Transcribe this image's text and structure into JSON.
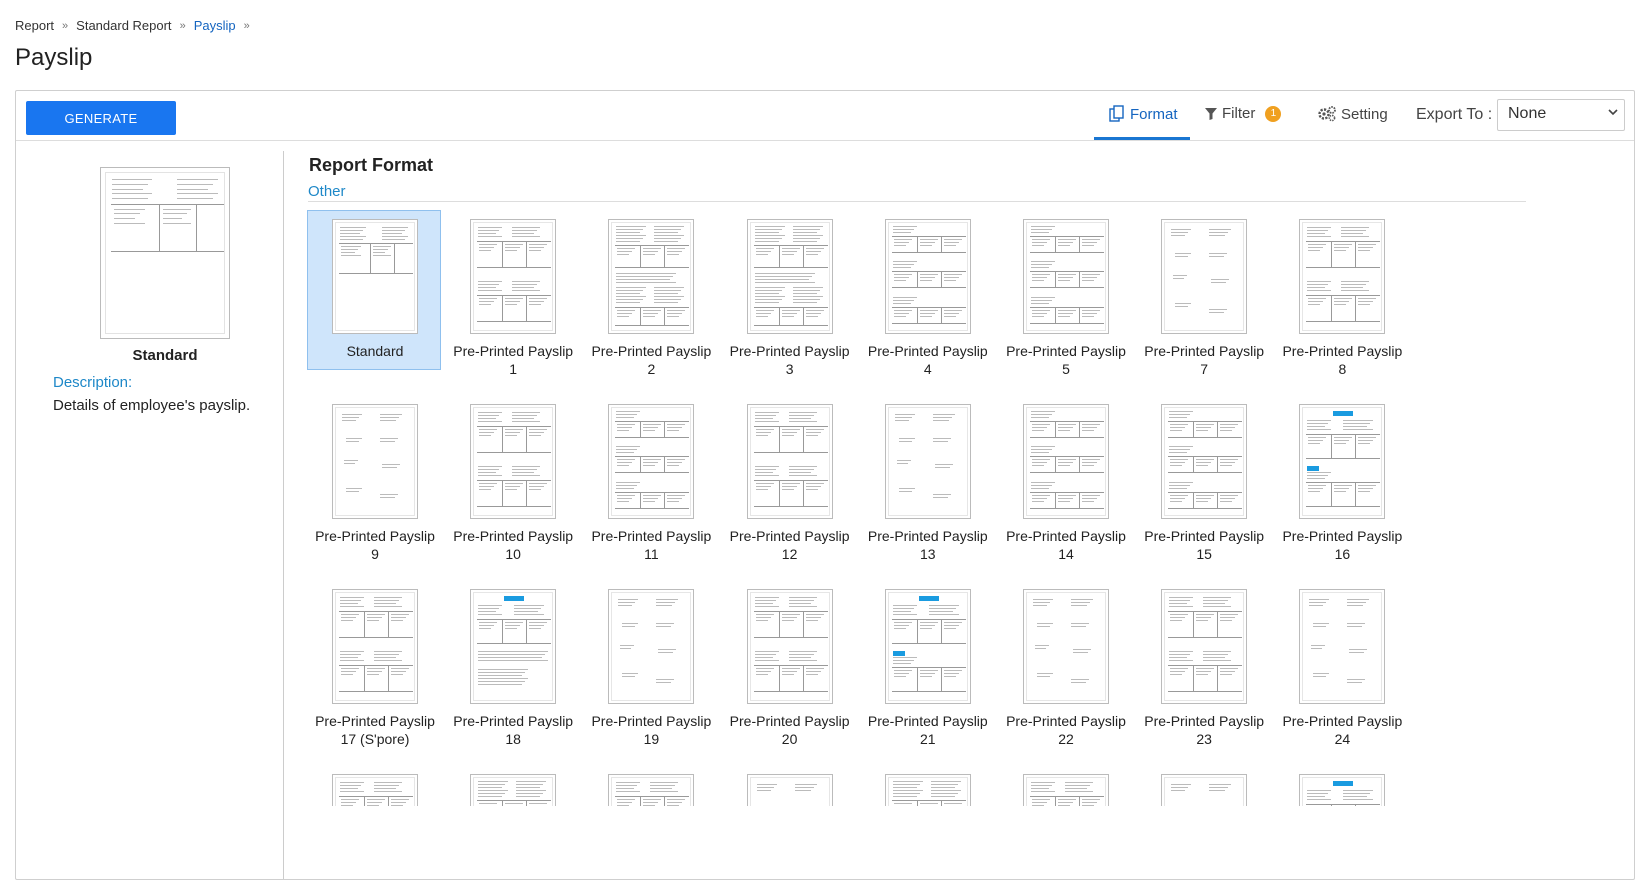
{
  "breadcrumb": {
    "items": [
      "Report",
      "Standard Report"
    ],
    "current": "Payslip"
  },
  "page_title": "Payslip",
  "toolbar": {
    "generate_label": "GENERATE",
    "format_label": "Format",
    "filter_label": "Filter",
    "filter_count": "1",
    "setting_label": "Setting",
    "export_label": "Export To :",
    "export_value": "None"
  },
  "selected": {
    "name": "Standard",
    "description_label": "Description:",
    "description": "Details of employee's payslip."
  },
  "report_format": {
    "title": "Report Format",
    "group": "Other",
    "items": [
      {
        "line1": "Standard",
        "line2": "",
        "style": "standard"
      },
      {
        "line1": "Pre-Printed Payslip",
        "line2": "1",
        "style": "double"
      },
      {
        "line1": "Pre-Printed Payslip",
        "line2": "2",
        "style": "dense"
      },
      {
        "line1": "Pre-Printed Payslip",
        "line2": "3",
        "style": "dense"
      },
      {
        "line1": "Pre-Printed Payslip",
        "line2": "4",
        "style": "triple"
      },
      {
        "line1": "Pre-Printed Payslip",
        "line2": "5",
        "style": "triple"
      },
      {
        "line1": "Pre-Printed Payslip",
        "line2": "7",
        "style": "sparse"
      },
      {
        "line1": "Pre-Printed Payslip",
        "line2": "8",
        "style": "double"
      },
      {
        "line1": "Pre-Printed Payslip",
        "line2": "9",
        "style": "sparse"
      },
      {
        "line1": "Pre-Printed Payslip",
        "line2": "10",
        "style": "double"
      },
      {
        "line1": "Pre-Printed Payslip",
        "line2": "11",
        "style": "triple"
      },
      {
        "line1": "Pre-Printed Payslip",
        "line2": "12",
        "style": "double"
      },
      {
        "line1": "Pre-Printed Payslip",
        "line2": "13",
        "style": "sparse"
      },
      {
        "line1": "Pre-Printed Payslip",
        "line2": "14",
        "style": "triple"
      },
      {
        "line1": "Pre-Printed Payslip",
        "line2": "15",
        "style": "triple"
      },
      {
        "line1": "Pre-Printed Payslip",
        "line2": "16",
        "style": "logo2"
      },
      {
        "line1": "Pre-Printed Payslip",
        "line2": "17 (S'pore)",
        "style": "double"
      },
      {
        "line1": "Pre-Printed Payslip",
        "line2": "18",
        "style": "logo"
      },
      {
        "line1": "Pre-Printed Payslip",
        "line2": "19",
        "style": "sparse"
      },
      {
        "line1": "Pre-Printed Payslip",
        "line2": "20",
        "style": "double"
      },
      {
        "line1": "Pre-Printed Payslip",
        "line2": "21",
        "style": "logo2"
      },
      {
        "line1": "Pre-Printed Payslip",
        "line2": "22",
        "style": "sparse"
      },
      {
        "line1": "Pre-Printed Payslip",
        "line2": "23",
        "style": "double"
      },
      {
        "line1": "Pre-Printed Payslip",
        "line2": "24",
        "style": "sparse"
      },
      {
        "line1": "",
        "line2": "",
        "style": "double"
      },
      {
        "line1": "",
        "line2": "",
        "style": "dense"
      },
      {
        "line1": "",
        "line2": "",
        "style": "double"
      },
      {
        "line1": "",
        "line2": "",
        "style": "sparse"
      },
      {
        "line1": "",
        "line2": "",
        "style": "dense"
      },
      {
        "line1": "",
        "line2": "",
        "style": "double"
      },
      {
        "line1": "",
        "line2": "",
        "style": "sparse"
      },
      {
        "line1": "",
        "line2": "",
        "style": "logo2"
      }
    ]
  },
  "icons": {
    "format": "format-icon",
    "filter": "filter-icon",
    "setting": "gear-icon",
    "breadcrumb_separator": "double-chevron-right-icon",
    "select_arrow": "chevron-down-icon"
  },
  "colors": {
    "primary": "#1976f0",
    "link": "#1e88c8",
    "selected_bg": "#cfe5fb",
    "badge": "#f0a020"
  }
}
